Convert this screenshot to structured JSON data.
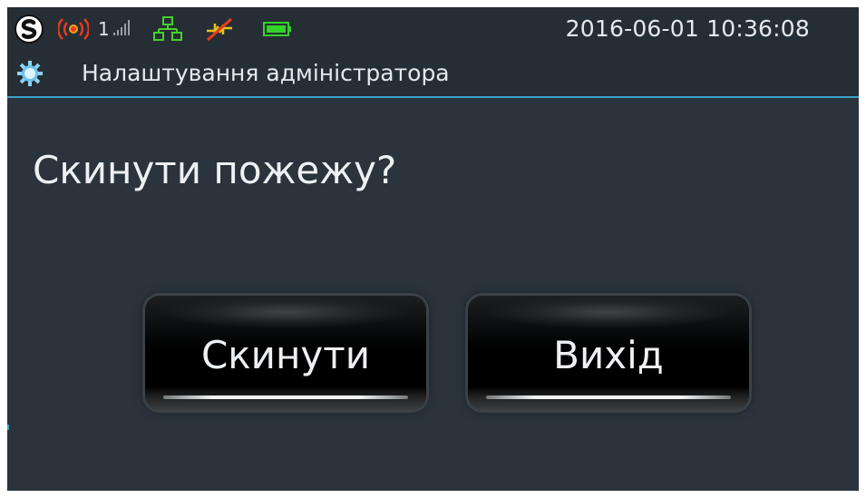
{
  "status_bar": {
    "signal_number": "1",
    "datetime": "2016-06-01 10:36:08",
    "icons": {
      "logo": "s-logo-icon",
      "alarm": "alarm-broadcast-icon",
      "signal": "signal-strength-icon",
      "network": "network-icon",
      "link": "link-disconnected-icon",
      "battery": "battery-icon"
    },
    "colors": {
      "alarm": "#e63b1f",
      "network": "#49d12b",
      "link_off": "#e6c21c",
      "battery": "#34d32a"
    }
  },
  "title_bar": {
    "icon": "gear-icon",
    "title": "Налаштування адміністратора",
    "accent": "#3aa1c9"
  },
  "dialog": {
    "question": "Скинути пожежу?",
    "buttons": {
      "reset_label": "Скинути",
      "exit_label": "Вихід"
    }
  }
}
